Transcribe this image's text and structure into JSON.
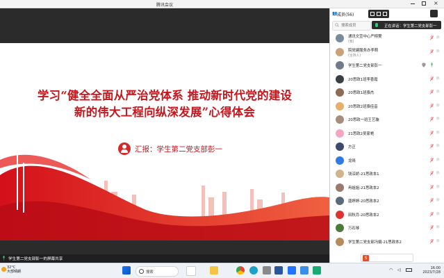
{
  "window": {
    "title": "腾讯会议"
  },
  "slide": {
    "title_line1": "学习“健全全面从严治党体系 推动新时代党的建设",
    "title_line2": "新的伟大工程向纵深发展”心得体会",
    "reporter": "汇报：学生第二党支部彭一"
  },
  "sharebar": {
    "label": "学生第二党支部彭一的屏幕共享"
  },
  "sidebar": {
    "title": "成员(56)",
    "search_placeholder": "搜索成员",
    "speaking": "正在讲话：学生第二党支部彭一",
    "participants": [
      {
        "name": "通讯文宣中心严栩樊",
        "sub": "(我)",
        "avatar": "#7a8a99",
        "action": "静"
      },
      {
        "name": "院党建服务办李萌",
        "sub": "(主持人)",
        "avatar": "#c9a27a",
        "action": "静"
      },
      {
        "name": "学生第二党支部彭一",
        "sub": "",
        "avatar": "#6f7b87",
        "action": ""
      },
      {
        "name": "20思政1班李香霞",
        "sub": "",
        "avatar": "#3b3f44",
        "action": "静"
      },
      {
        "name": "20思政1班骆杰",
        "sub": "",
        "avatar": "#8d6b55",
        "action": "静"
      },
      {
        "name": "20思政2班骆佳音",
        "sub": "",
        "avatar": "#e7b06a",
        "action": "静"
      },
      {
        "name": "20思政一班王艺璇",
        "sub": "",
        "avatar": "#a58d7a",
        "action": "静"
      },
      {
        "name": "21思政2吴家艳",
        "sub": "",
        "avatar": "#f3a6c1",
        "action": "静"
      },
      {
        "name": "方正",
        "sub": "",
        "avatar": "#3c4a6b",
        "action": "静"
      },
      {
        "name": "龙晓",
        "sub": "",
        "avatar": "#2f7be0",
        "action": "静"
      },
      {
        "name": "钱沿娇-21思政本1",
        "sub": "",
        "avatar": "#d2b48c",
        "action": "静"
      },
      {
        "name": "冉姐姐-21思政本2",
        "sub": "",
        "avatar": "#9a7b6b",
        "action": "静"
      },
      {
        "name": "唐婷婷-20思政本2",
        "sub": "",
        "avatar": "#5b6b7a",
        "action": "静"
      },
      {
        "name": "田秋月-20思政本2",
        "sub": "",
        "avatar": "#d33",
        "action": "静"
      },
      {
        "name": "万石琴",
        "sub": "",
        "avatar": "#4b7a3a",
        "action": "静"
      },
      {
        "name": "学生第二党支部冯娟-21思政本2",
        "sub": "",
        "avatar": "#b68a5c",
        "action": "静"
      }
    ]
  },
  "taskbar": {
    "weather_temp": "32°C",
    "weather_desc": "大部晴朗",
    "search_label": "搜索",
    "time": "16:00",
    "date": "2023/7/28"
  },
  "colors": {
    "slide_red": "#c8161d",
    "stage_dark": "#2b2b2b"
  }
}
